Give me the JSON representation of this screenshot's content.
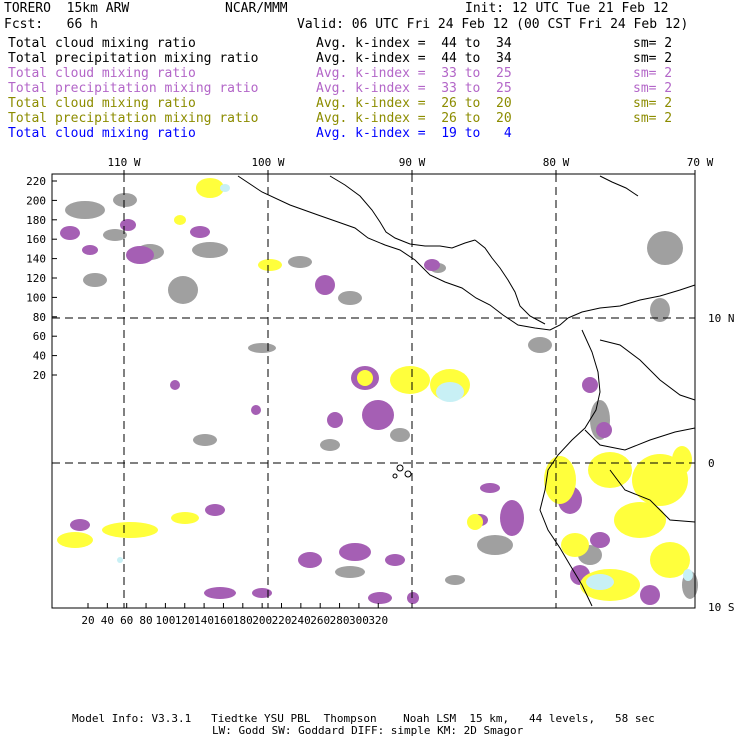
{
  "header": {
    "model": "TORERO  15km ARW",
    "org": "NCAR/MMM",
    "init": "Init: 12 UTC Tue 21 Feb 12",
    "fcst": "Fcst:   66 h",
    "valid": "Valid: 06 UTC Fri 24 Feb 12 (00 CST Fri 24 Feb 12)"
  },
  "legend": [
    {
      "field": "Total cloud mixing ratio",
      "kindex": "Avg. k-index =  44 to  34",
      "sm": "sm= 2",
      "color": "#000000"
    },
    {
      "field": "Total precipitation mixing ratio",
      "kindex": "Avg. k-index =  44 to  34",
      "sm": "sm= 2",
      "color": "#000000"
    },
    {
      "field": "Total cloud mixing ratio",
      "kindex": "Avg. k-index =  33 to  25",
      "sm": "sm= 2",
      "color": "#b366c8"
    },
    {
      "field": "Total precipitation mixing ratio",
      "kindex": "Avg. k-index =  33 to  25",
      "sm": "sm= 2",
      "color": "#b366c8"
    },
    {
      "field": "Total cloud mixing ratio",
      "kindex": "Avg. k-index =  26 to  20",
      "sm": "sm= 2",
      "color": "#8c8c00"
    },
    {
      "field": "Total precipitation mixing ratio",
      "kindex": "Avg. k-index =  26 to  20",
      "sm": "sm= 2",
      "color": "#8c8c00"
    },
    {
      "field": "Total cloud mixing ratio",
      "kindex": "Avg. k-index =  19 to   4",
      "sm": "",
      "color": "#0000ff"
    }
  ],
  "map": {
    "lon_labels": [
      "110 W",
      "100 W",
      "90 W",
      "80 W",
      "70 W"
    ],
    "lat_labels": [
      "10 N",
      "0",
      "10 S"
    ],
    "y_ticks": [
      "220",
      "200",
      "180",
      "160",
      "140",
      "120",
      "100",
      "80",
      "60",
      "40",
      "20"
    ],
    "x_ticks": [
      "20",
      "40",
      "60",
      "80",
      "100",
      "120",
      "140",
      "160",
      "180",
      "200",
      "220",
      "240",
      "260",
      "280",
      "300",
      "320"
    ],
    "colors": {
      "gray": "#a0a0a0",
      "purple": "#a55fb4",
      "yellow": "#ffff3c",
      "lightblue": "#c8f0f5"
    }
  },
  "footer": {
    "line1": "Model Info: V3.3.1   Tiedtke YSU PBL  Thompson    Noah LSM  15 km,   44 levels,   58 sec",
    "line2": "LW: Godd SW: Goddard DIFF: simple KM: 2D Smagor"
  }
}
